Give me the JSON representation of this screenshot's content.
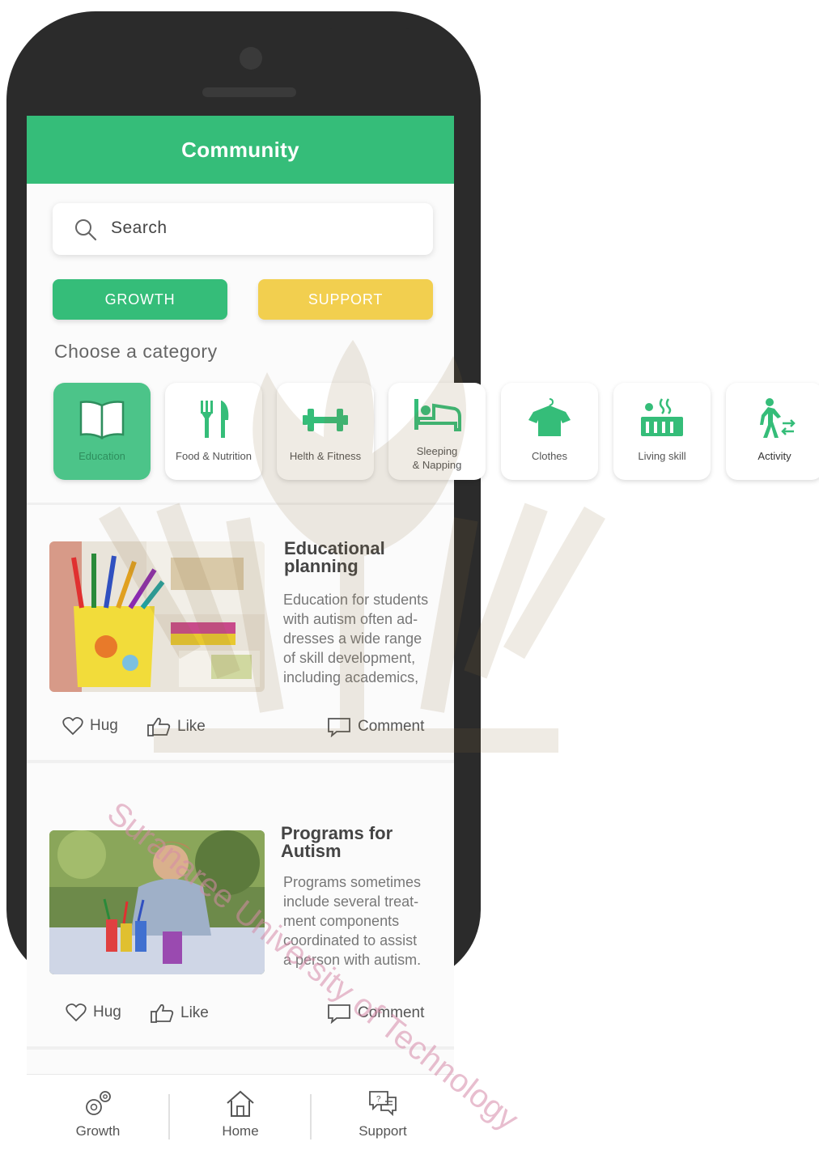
{
  "header": {
    "title": "Community"
  },
  "search": {
    "placeholder": "Search"
  },
  "tabs": {
    "growth": "GROWTH",
    "support": "SUPPORT"
  },
  "category_heading": "Choose a category",
  "categories": [
    {
      "label": "Education",
      "icon": "book-icon"
    },
    {
      "label": "Food & Nutrition",
      "icon": "fork-knife-icon"
    },
    {
      "label": "Helth & Fitness",
      "icon": "dumbbell-icon"
    },
    {
      "label_line1": "Sleeping",
      "label_line2": "& Napping",
      "icon": "bed-icon"
    },
    {
      "label": "Clothes",
      "icon": "shirt-icon"
    },
    {
      "label": "Living skill",
      "icon": "cooking-icon"
    },
    {
      "label": "Activity",
      "icon": "walking-person-icon"
    }
  ],
  "posts": [
    {
      "title_line1": "Educational",
      "title_line2": "planning",
      "body": [
        "Education for students",
        "with autism often ad-",
        "dresses a wide range",
        "of skill development,",
        "including academics,"
      ],
      "hug": "Hug",
      "like": "Like",
      "comment": "Comment"
    },
    {
      "title_line1": "Programs for",
      "title_line2": "Autism",
      "body": [
        "Programs sometimes",
        "include several treat-",
        "ment components",
        "coordinated to assist",
        "a person with autism."
      ],
      "hug": "Hug",
      "like": "Like",
      "comment": "Comment"
    }
  ],
  "bottom_nav": {
    "growth": "Growth",
    "home": "Home",
    "support": "Support"
  },
  "watermark_text": "Suranaree University of Technology",
  "colors": {
    "green": "#35bd79",
    "yellow": "#f2cf4f"
  }
}
